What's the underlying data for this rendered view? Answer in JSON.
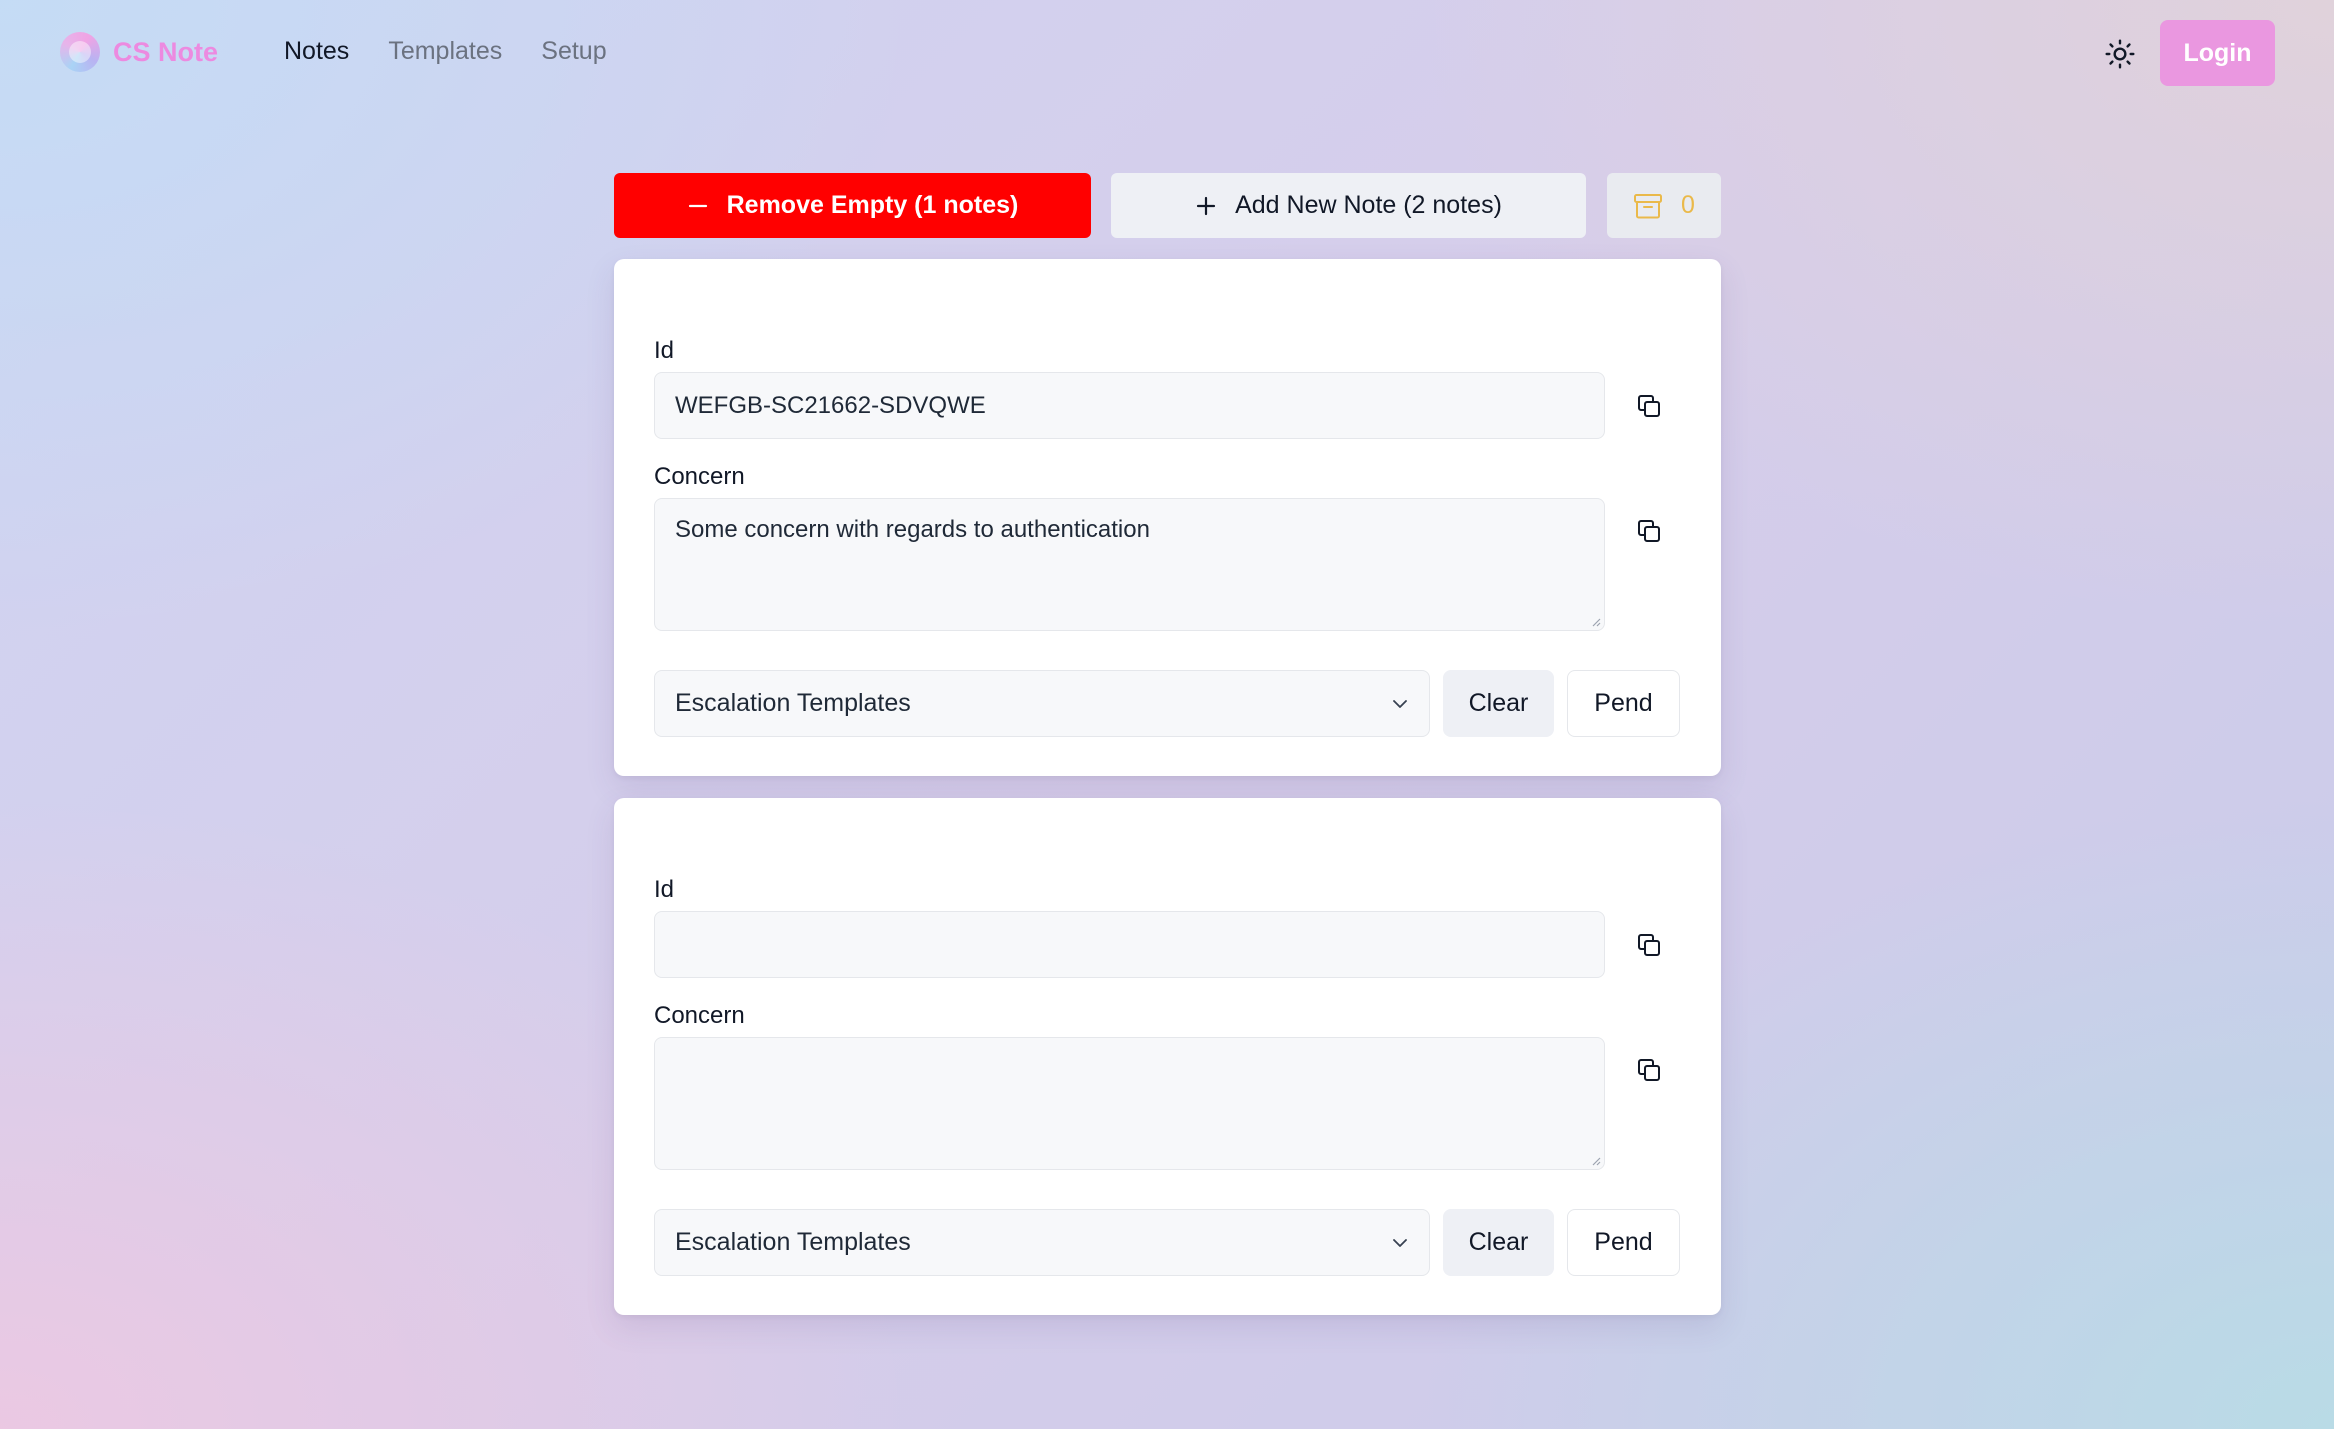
{
  "app": {
    "name": "CS Note",
    "brand_color": "#ec8ae0"
  },
  "nav": {
    "items": [
      {
        "label": "Notes",
        "active": true
      },
      {
        "label": "Templates",
        "active": false
      },
      {
        "label": "Setup",
        "active": false
      }
    ]
  },
  "header": {
    "theme_icon": "sun-icon",
    "login_label": "Login"
  },
  "toolbar": {
    "remove_label": "Remove Empty (1 notes)",
    "add_label": "Add New Note (2 notes)",
    "archive_count": "0",
    "remove_color": "#ff0000",
    "archive_color": "#eab94a"
  },
  "notes": [
    {
      "id_label": "Id",
      "id_value": "WEFGB-SC21662-SDVQWE",
      "concern_label": "Concern",
      "concern_value": "Some concern with regards to authentication",
      "template_select": "Escalation Templates",
      "clear_label": "Clear",
      "pend_label": "Pend"
    },
    {
      "id_label": "Id",
      "id_value": "",
      "concern_label": "Concern",
      "concern_value": "",
      "template_select": "Escalation Templates",
      "clear_label": "Clear",
      "pend_label": "Pend"
    }
  ]
}
